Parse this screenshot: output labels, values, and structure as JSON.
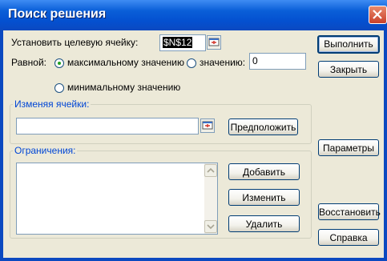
{
  "window": {
    "title": "Поиск решения"
  },
  "target": {
    "label": "Установить целевую ячейку:",
    "value": "$N$12"
  },
  "equal": {
    "label": "Равной:",
    "options": {
      "max": "максимальному значению",
      "value": "значению:",
      "min": "минимальному значению"
    },
    "value_field": "0",
    "selected": "max"
  },
  "changing": {
    "legend": "Изменяя ячейки:",
    "value": "",
    "guess_label": "Предположить"
  },
  "constraints": {
    "legend": "Ограничения:",
    "add_label": "Добавить",
    "change_label": "Изменить",
    "delete_label": "Удалить"
  },
  "buttons": {
    "solve": "Выполнить",
    "close": "Закрыть",
    "options": "Параметры",
    "reset": "Восстановить",
    "help": "Справка"
  },
  "colors": {
    "title_bar": "#0450d0",
    "dialog_bg": "#ece9d8",
    "legend_text": "#0046d5",
    "close_button": "#c9402a"
  }
}
